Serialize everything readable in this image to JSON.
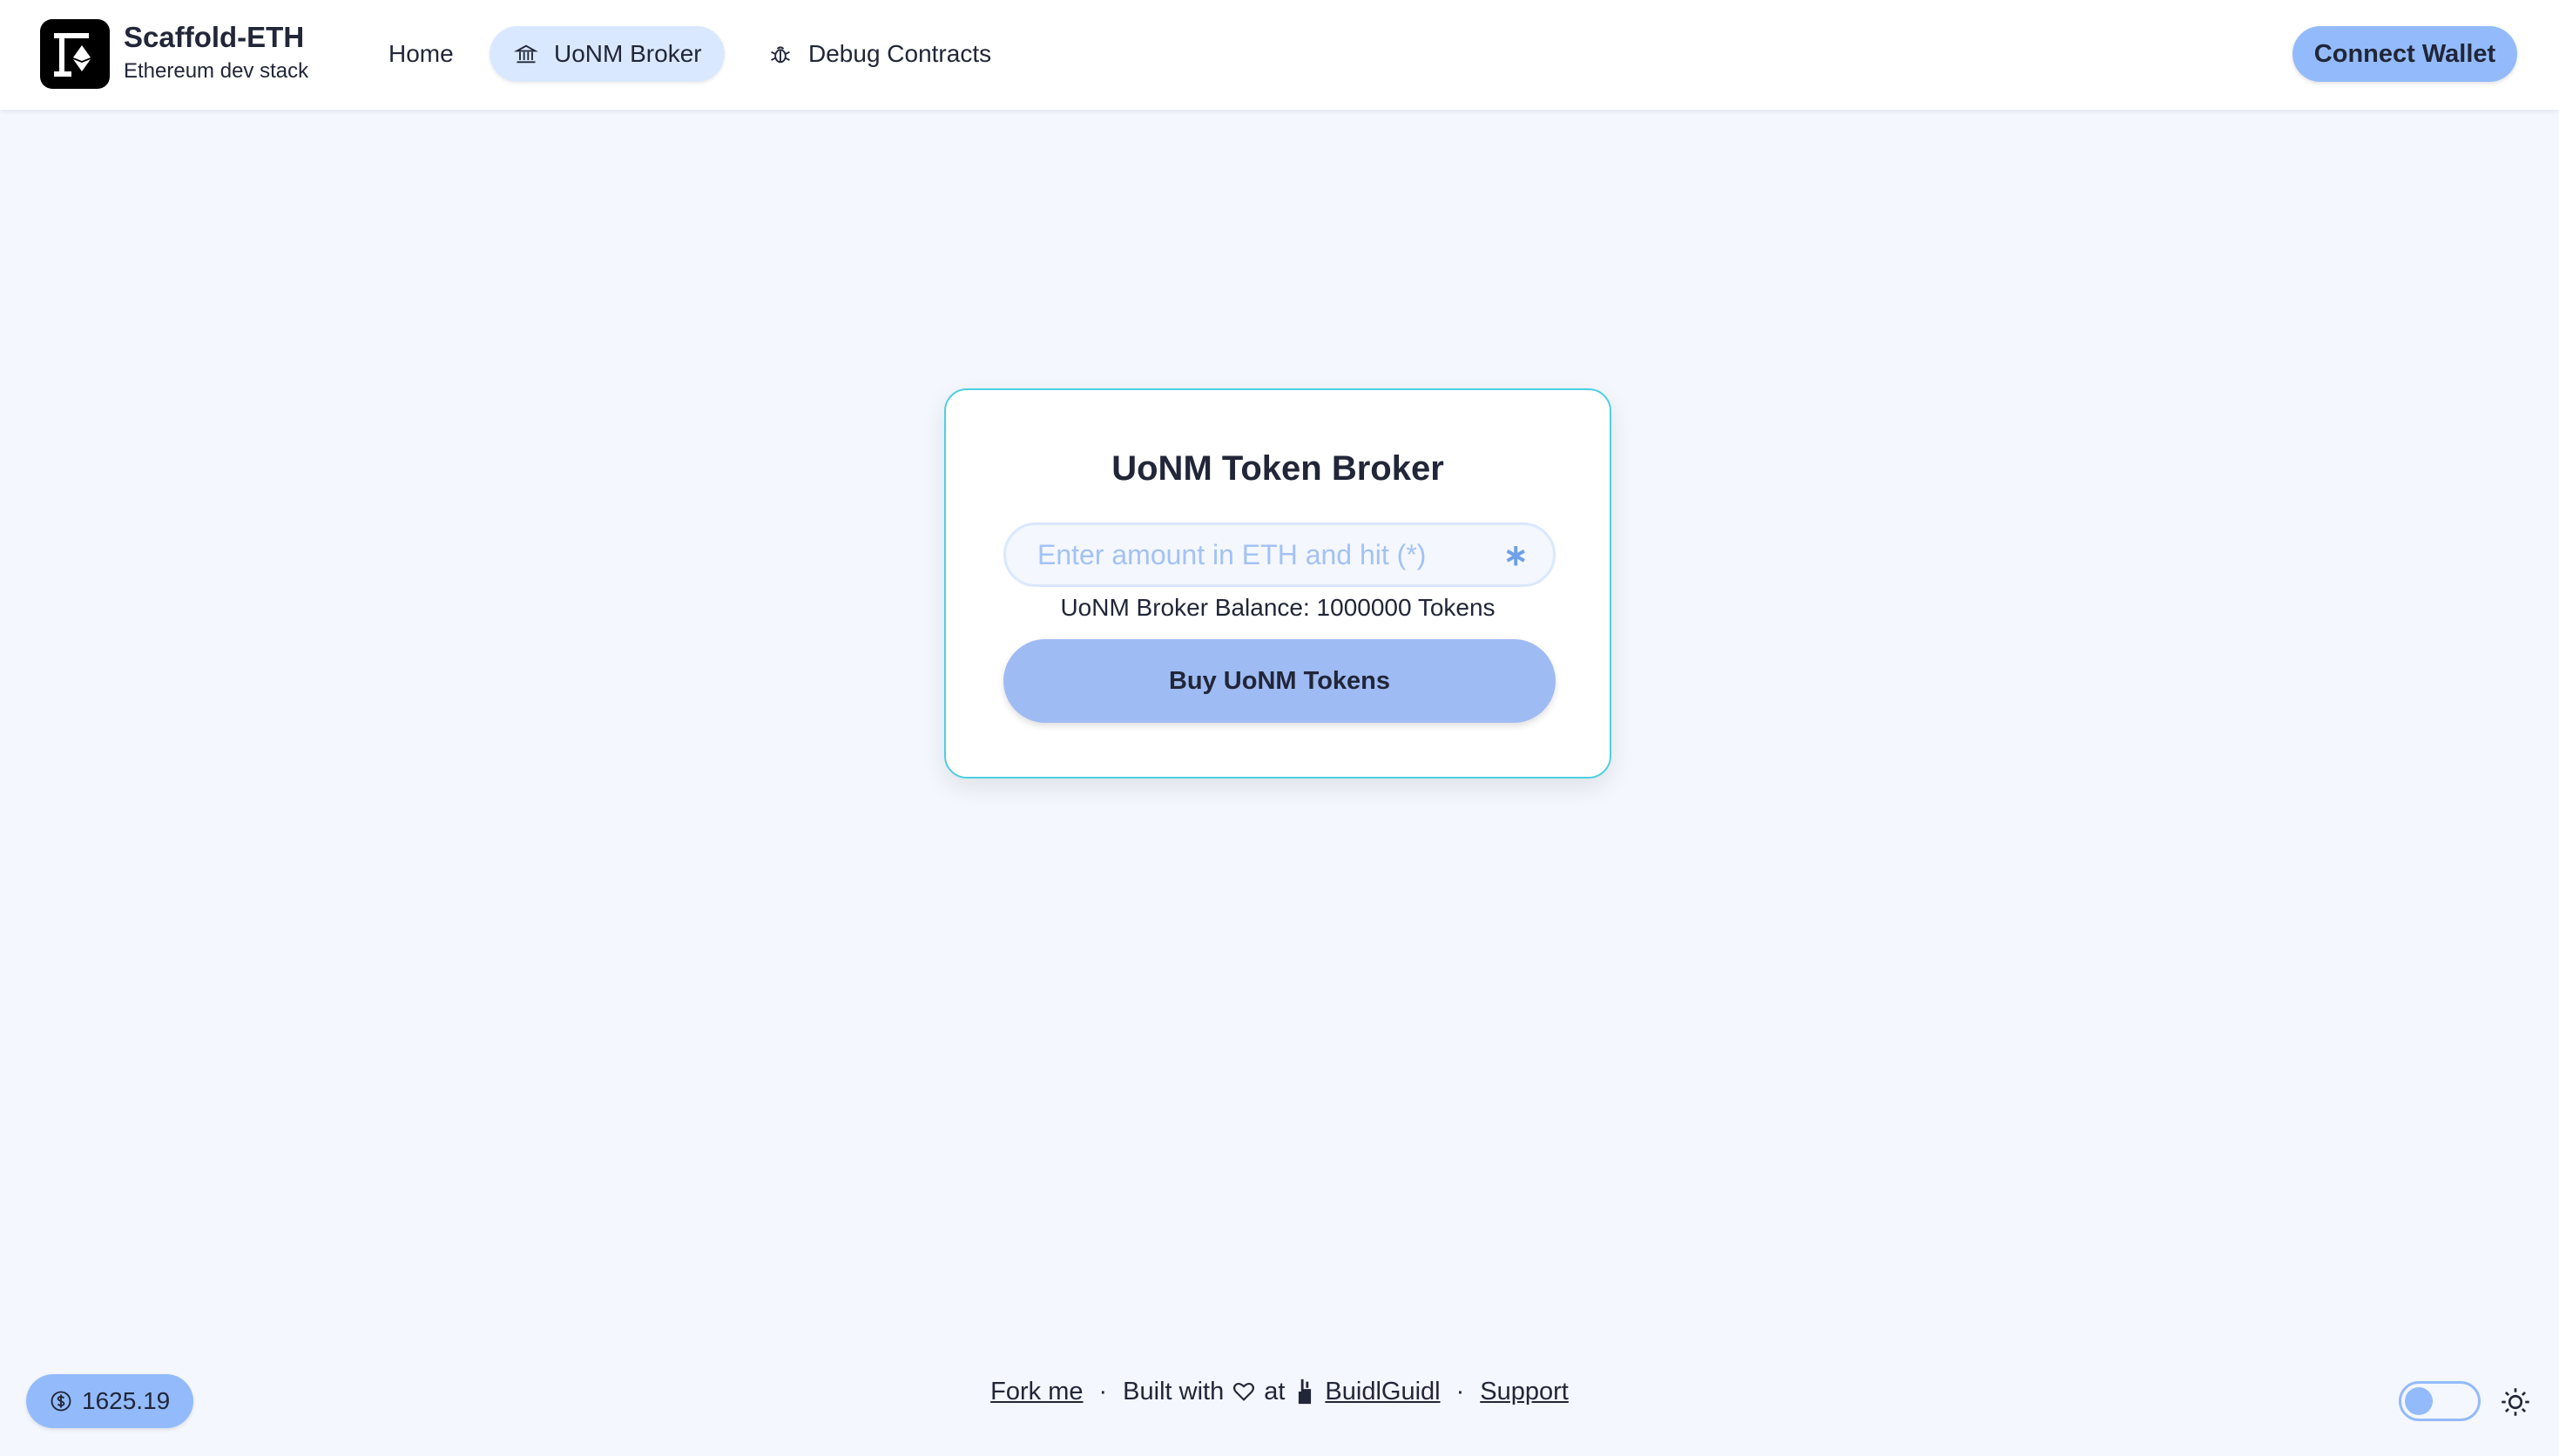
{
  "header": {
    "brand_title": "Scaffold-ETH",
    "brand_subtitle": "Ethereum dev stack",
    "nav": [
      {
        "label": "Home",
        "icon": "none",
        "active": false
      },
      {
        "label": "UoNM Broker",
        "icon": "bank-icon",
        "active": true
      },
      {
        "label": "Debug Contracts",
        "icon": "bug-icon",
        "active": false
      }
    ],
    "connect_label": "Connect Wallet"
  },
  "card": {
    "title": "UoNM Token Broker",
    "input_placeholder": "Enter amount in ETH and hit (*)",
    "input_value": "",
    "star_symbol": "∗",
    "balance_text": "UoNM Broker Balance: 1000000 Tokens",
    "buy_label": "Buy UoNM Tokens"
  },
  "footer": {
    "eth_price": "1625.19",
    "fork_label": "Fork me",
    "built_with": "Built with",
    "at": "at",
    "buidlguidl": "BuidlGuidl",
    "support": "Support",
    "separator": "·"
  },
  "colors": {
    "accent": "#93bbfb",
    "background": "#f4f7fd",
    "active_nav": "#dae8ff",
    "card_border": "#4dd0e1",
    "text": "#212638"
  }
}
